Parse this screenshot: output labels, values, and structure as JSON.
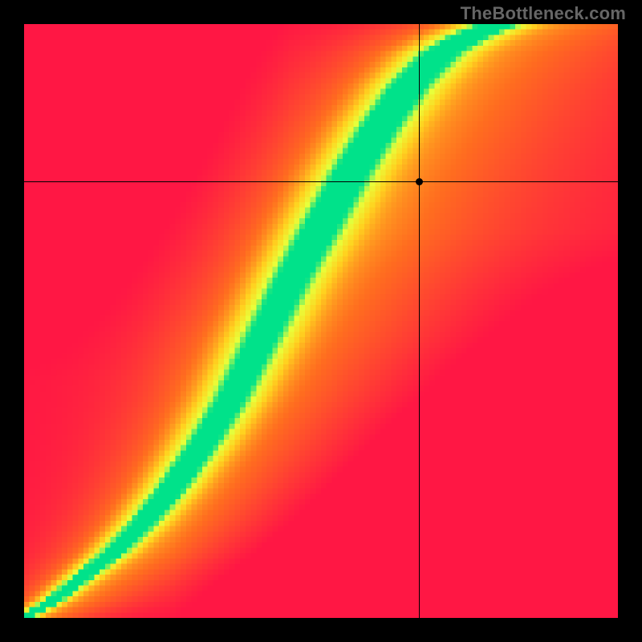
{
  "watermark": "TheBottleneck.com",
  "chart_data": {
    "type": "heatmap",
    "title": "",
    "xlabel": "",
    "ylabel": "",
    "xlim": [
      0,
      1
    ],
    "ylim": [
      0,
      1
    ],
    "marker": {
      "x": 0.665,
      "y": 0.735
    },
    "crosshair": {
      "x": 0.665,
      "y": 0.735
    },
    "optimal_curve_x": [
      0.0,
      0.05,
      0.1,
      0.15,
      0.2,
      0.25,
      0.3,
      0.35,
      0.4,
      0.45,
      0.5,
      0.55,
      0.6,
      0.65,
      0.7,
      0.75,
      0.8
    ],
    "optimal_curve_y": [
      0.0,
      0.03,
      0.07,
      0.11,
      0.16,
      0.22,
      0.29,
      0.37,
      0.47,
      0.57,
      0.66,
      0.75,
      0.83,
      0.9,
      0.95,
      0.98,
      1.0
    ],
    "band_width": [
      0.02,
      0.025,
      0.03,
      0.035,
      0.04,
      0.045,
      0.05,
      0.055,
      0.06,
      0.06,
      0.06,
      0.06,
      0.06,
      0.06,
      0.06,
      0.06,
      0.06
    ],
    "color_stops": [
      {
        "t": 0.0,
        "color": "#ff1744"
      },
      {
        "t": 0.35,
        "color": "#ff6d1f"
      },
      {
        "t": 0.65,
        "color": "#ffd21f"
      },
      {
        "t": 0.85,
        "color": "#e8ff3a"
      },
      {
        "t": 1.0,
        "color": "#00e28a"
      }
    ],
    "grid_resolution": 110
  }
}
